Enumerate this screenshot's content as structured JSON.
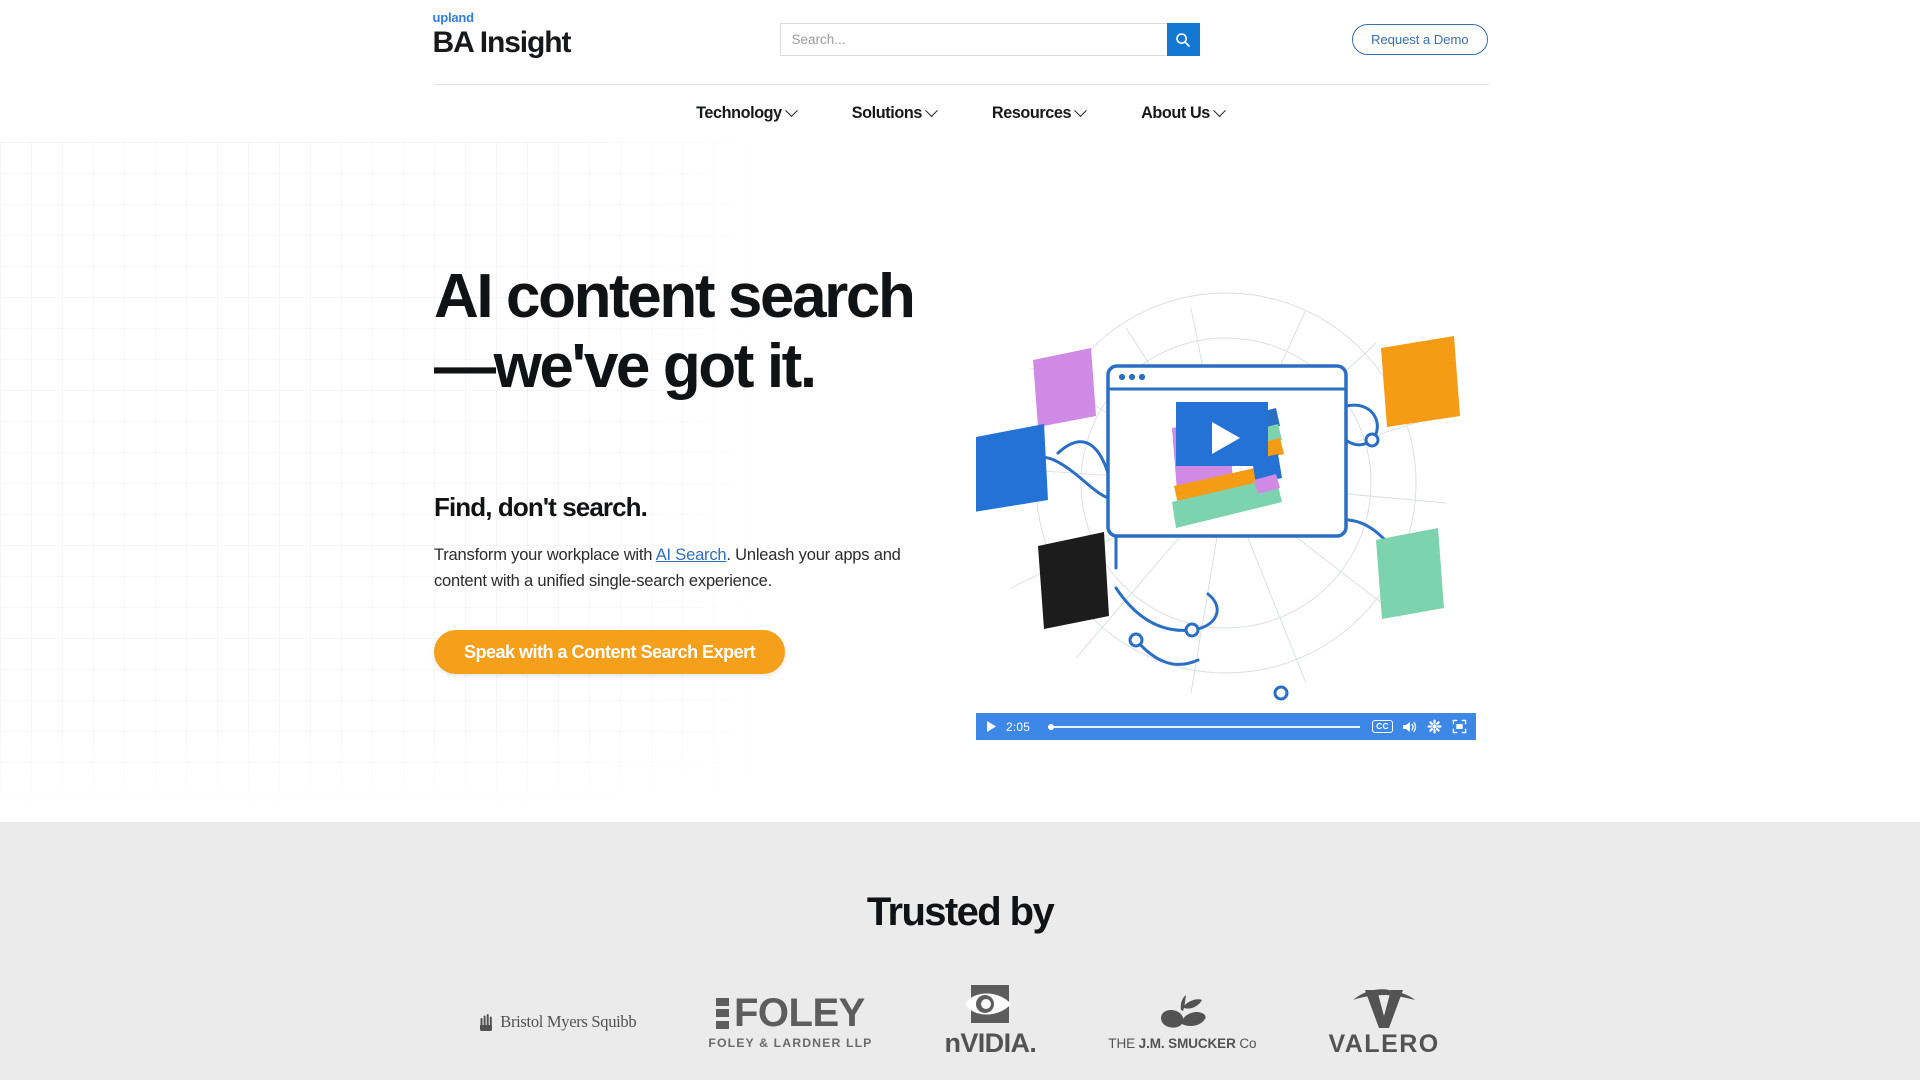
{
  "header": {
    "brand_upland": "upland",
    "brand_name": "BA Insight",
    "search": {
      "placeholder": "Search...",
      "value": "",
      "icon": "search-icon"
    },
    "demo_button": "Request a Demo"
  },
  "nav": {
    "items": [
      {
        "label": "Technology",
        "icon": "chevron-down-icon"
      },
      {
        "label": "Solutions",
        "icon": "chevron-down-icon"
      },
      {
        "label": "Resources",
        "icon": "chevron-down-icon"
      },
      {
        "label": "About Us",
        "icon": "chevron-down-icon"
      }
    ]
  },
  "hero": {
    "heading": "AI content search—we've got it.",
    "subheading": "Find, don't search.",
    "body_before_link": "Transform your workplace with ",
    "body_link": "AI Search",
    "body_after_link": ". Unleash your apps and content with a unified single-search experience.",
    "cta_label": "Speak with a Content Search Expert",
    "cta_color": "#f5a01b"
  },
  "video": {
    "time": "2:05",
    "play_icon": "play-icon",
    "cc_label": "CC",
    "volume_icon": "volume-icon",
    "settings_icon": "gear-icon",
    "fullscreen_icon": "fullscreen-icon",
    "bar_color": "#3d87e6",
    "progress_percent": 0
  },
  "trusted": {
    "title": "Trusted by",
    "logos": [
      {
        "name": "Bristol Myers Squibb",
        "text": "Bristol Myers Squibb"
      },
      {
        "name": "Foley & Lardner LLP",
        "word": "FOLEY",
        "sub": "FOLEY & LARDNER LLP"
      },
      {
        "name": "NVIDIA",
        "word": "nVIDIA."
      },
      {
        "name": "The J.M. Smucker Co",
        "text_pre": "THE ",
        "text_bold": "J.M. SMUCKER ",
        "text_post": "Co"
      },
      {
        "name": "Valero",
        "word": "VALERO"
      }
    ]
  }
}
